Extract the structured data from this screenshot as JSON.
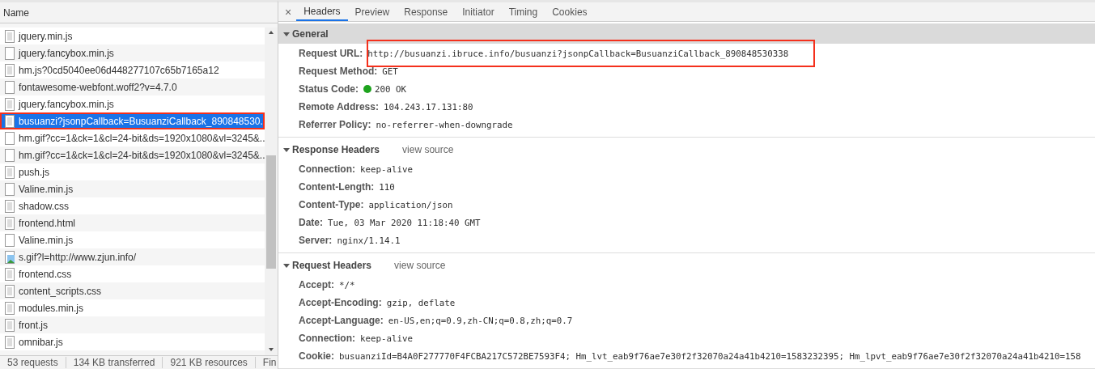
{
  "network_list": {
    "column_header": "Name",
    "rows": [
      {
        "name": "jquery.min.js",
        "kind": "doc",
        "selected": false,
        "annotated": false
      },
      {
        "name": "jquery.fancybox.min.js",
        "kind": "blank",
        "selected": false,
        "annotated": false
      },
      {
        "name": "hm.js?0cd5040ee06d448277107c65b7165a12",
        "kind": "doc",
        "selected": false,
        "annotated": false
      },
      {
        "name": "fontawesome-webfont.woff2?v=4.7.0",
        "kind": "blank",
        "selected": false,
        "annotated": false
      },
      {
        "name": "jquery.fancybox.min.js",
        "kind": "doc",
        "selected": false,
        "annotated": false
      },
      {
        "name": "busuanzi?jsonpCallback=BusuanziCallback_890848530.",
        "kind": "doc",
        "selected": true,
        "annotated": true
      },
      {
        "name": "hm.gif?cc=1&ck=1&cl=24-bit&ds=1920x1080&vl=3245&..",
        "kind": "blank",
        "selected": false,
        "annotated": false
      },
      {
        "name": "hm.gif?cc=1&ck=1&cl=24-bit&ds=1920x1080&vl=3245&..",
        "kind": "blank",
        "selected": false,
        "annotated": false
      },
      {
        "name": "push.js",
        "kind": "doc",
        "selected": false,
        "annotated": false
      },
      {
        "name": "Valine.min.js",
        "kind": "blank",
        "selected": false,
        "annotated": false
      },
      {
        "name": "shadow.css",
        "kind": "doc",
        "selected": false,
        "annotated": false
      },
      {
        "name": "frontend.html",
        "kind": "doc",
        "selected": false,
        "annotated": false
      },
      {
        "name": "Valine.min.js",
        "kind": "blank",
        "selected": false,
        "annotated": false
      },
      {
        "name": "s.gif?l=http://www.zjun.info/",
        "kind": "image",
        "selected": false,
        "annotated": false
      },
      {
        "name": "frontend.css",
        "kind": "doc",
        "selected": false,
        "annotated": false
      },
      {
        "name": "content_scripts.css",
        "kind": "doc",
        "selected": false,
        "annotated": false
      },
      {
        "name": "modules.min.js",
        "kind": "doc",
        "selected": false,
        "annotated": false
      },
      {
        "name": "front.js",
        "kind": "doc",
        "selected": false,
        "annotated": false
      },
      {
        "name": "omnibar.js",
        "kind": "doc",
        "selected": false,
        "annotated": false
      }
    ]
  },
  "status_bar": [
    "53 requests",
    "134 KB transferred",
    "921 KB resources",
    "Fin"
  ],
  "detail_panel": {
    "close": "×",
    "tabs": [
      {
        "label": "Headers",
        "selected": true
      },
      {
        "label": "Preview",
        "selected": false
      },
      {
        "label": "Response",
        "selected": false
      },
      {
        "label": "Initiator",
        "selected": false
      },
      {
        "label": "Timing",
        "selected": false
      },
      {
        "label": "Cookies",
        "selected": false
      }
    ],
    "sections": [
      {
        "title": "General",
        "shaded": true,
        "expanded": true,
        "rows": [
          {
            "key": "Request URL:",
            "value": "http://busuanzi.ibruce.info/busuanzi?jsonpCallback=BusuanziCallback_890848530338",
            "annotated": true
          },
          {
            "key": "Request Method:",
            "value": "GET",
            "annotated": false
          },
          {
            "key": "Status Code:",
            "value": "200 OK",
            "annotated": false,
            "color": "#1ea31e"
          },
          {
            "key": "Remote Address:",
            "value": "104.243.17.131:80",
            "annotated": false
          },
          {
            "key": "Referrer Policy:",
            "value": "no-referrer-when-downgrade",
            "annotated": false
          }
        ]
      },
      {
        "title": "Response Headers",
        "link": "view source",
        "shaded": false,
        "expanded": true,
        "rows": [
          {
            "key": "Connection:",
            "value": "keep-alive",
            "annotated": false
          },
          {
            "key": "Content-Length:",
            "value": "110",
            "annotated": false
          },
          {
            "key": "Content-Type:",
            "value": "application/json",
            "annotated": false
          },
          {
            "key": "Date:",
            "value": "Tue, 03 Mar 2020 11:18:40 GMT",
            "annotated": false
          },
          {
            "key": "Server:",
            "value": "nginx/1.14.1",
            "annotated": false
          }
        ]
      },
      {
        "title": "Request Headers",
        "link": "view source",
        "shaded": false,
        "expanded": true,
        "rows": [
          {
            "key": "Accept:",
            "value": "*/*",
            "annotated": false
          },
          {
            "key": "Accept-Encoding:",
            "value": "gzip, deflate",
            "annotated": false
          },
          {
            "key": "Accept-Language:",
            "value": "en-US,en;q=0.9,zh-CN;q=0.8,zh;q=0.7",
            "annotated": false
          },
          {
            "key": "Connection:",
            "value": "keep-alive",
            "annotated": false
          },
          {
            "key": "Cookie:",
            "value": "busuanziId=B4A0F277770F4FCBA217C572BE7593F4; Hm_lvt_eab9f76ae7e30f2f32070a24a41b4210=1583232395; Hm_lpvt_eab9f76ae7e30f2f32070a24a41b4210=158",
            "annotated": false
          }
        ]
      }
    ]
  }
}
